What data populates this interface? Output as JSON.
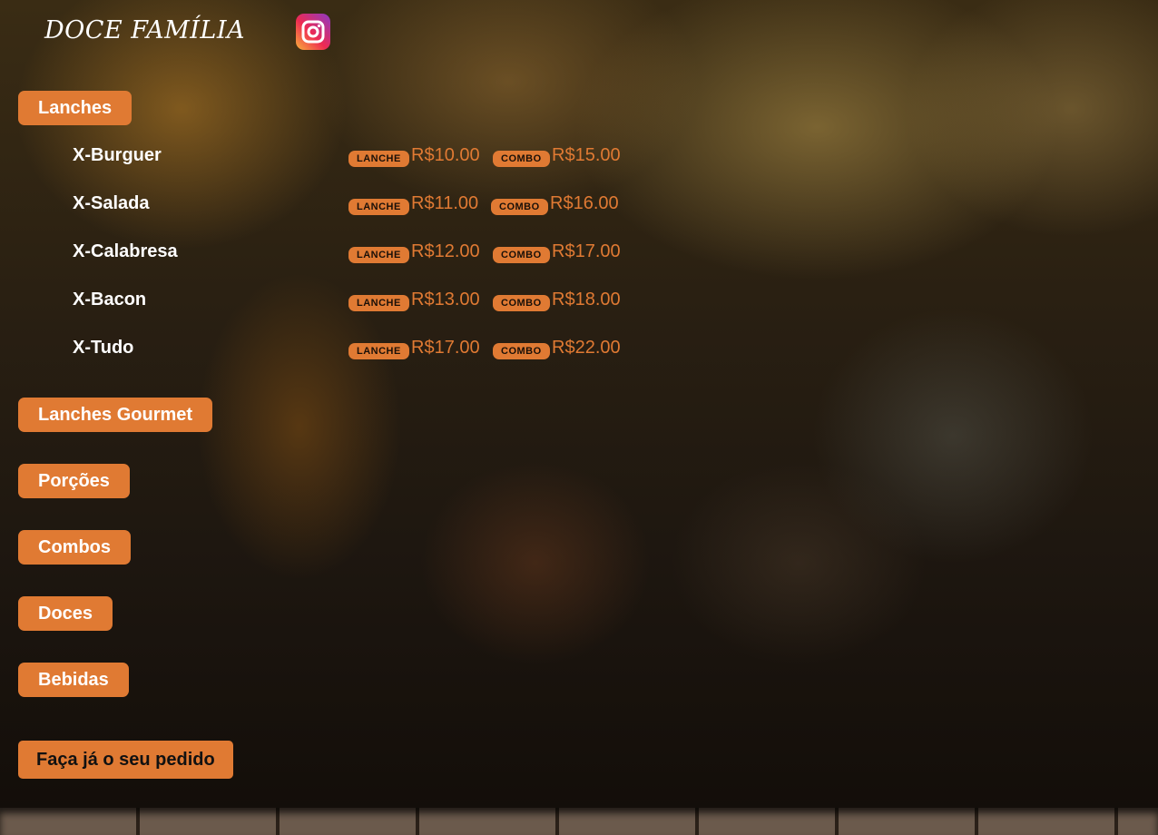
{
  "header": {
    "brand": "DOCE FAMÍLIA",
    "instagram_icon": "instagram-icon"
  },
  "categories": [
    {
      "label": "Lanches"
    },
    {
      "label": "Lanches Gourmet"
    },
    {
      "label": "Porções"
    },
    {
      "label": "Combos"
    },
    {
      "label": "Doces"
    },
    {
      "label": "Bebidas"
    }
  ],
  "menu_items": [
    {
      "name": "X-Burguer",
      "tag_lanche": "LANCHE",
      "price_lanche": "R$10.00",
      "tag_combo": "COMBO",
      "price_combo": "R$15.00"
    },
    {
      "name": "X-Salada",
      "tag_lanche": "LANCHE",
      "price_lanche": "R$11.00",
      "tag_combo": "COMBO",
      "price_combo": "R$16.00"
    },
    {
      "name": "X-Calabresa",
      "tag_lanche": "LANCHE",
      "price_lanche": "R$12.00",
      "tag_combo": "COMBO",
      "price_combo": "R$17.00"
    },
    {
      "name": "X-Bacon",
      "tag_lanche": "LANCHE",
      "price_lanche": "R$13.00",
      "tag_combo": "COMBO",
      "price_combo": "R$18.00"
    },
    {
      "name": "X-Tudo",
      "tag_lanche": "LANCHE",
      "price_lanche": "R$17.00",
      "tag_combo": "COMBO",
      "price_combo": "R$22.00"
    }
  ],
  "order_button": {
    "label": "Faça já o seu pedido"
  },
  "colors": {
    "accent": "#e07a33",
    "text": "#ffffff"
  }
}
